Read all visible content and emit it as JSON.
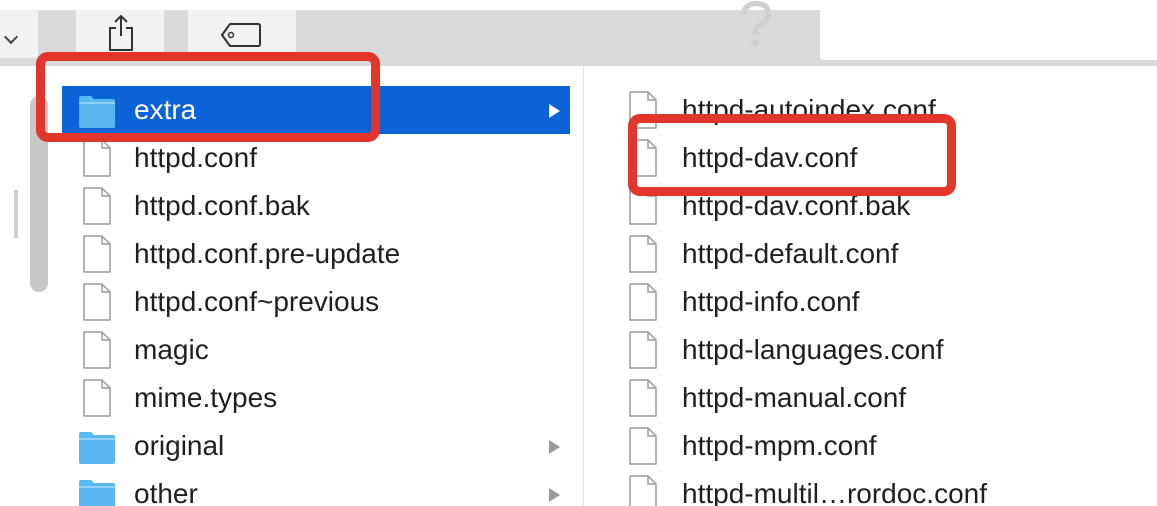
{
  "toolbar": {
    "buttons": [
      {
        "name": "view-options",
        "icon": "chevron-down-icon"
      },
      {
        "name": "share",
        "icon": "share-icon"
      },
      {
        "name": "tags",
        "icon": "tag-icon"
      }
    ],
    "help_glyph": "?"
  },
  "left_column": {
    "items": [
      {
        "label": "extra",
        "kind": "folder",
        "selected": true,
        "has_children": true
      },
      {
        "label": "httpd.conf",
        "kind": "file"
      },
      {
        "label": "httpd.conf.bak",
        "kind": "file"
      },
      {
        "label": "httpd.conf.pre-update",
        "kind": "file"
      },
      {
        "label": "httpd.conf~previous",
        "kind": "file"
      },
      {
        "label": "magic",
        "kind": "file"
      },
      {
        "label": "mime.types",
        "kind": "file"
      },
      {
        "label": "original",
        "kind": "folder",
        "has_children": true
      },
      {
        "label": "other",
        "kind": "folder",
        "has_children": true
      }
    ]
  },
  "right_column": {
    "items": [
      {
        "label": "httpd-autoindex.conf",
        "kind": "file"
      },
      {
        "label": "httpd-dav.conf",
        "kind": "file"
      },
      {
        "label": "httpd-dav.conf.bak",
        "kind": "file"
      },
      {
        "label": "httpd-default.conf",
        "kind": "file"
      },
      {
        "label": "httpd-info.conf",
        "kind": "file"
      },
      {
        "label": "httpd-languages.conf",
        "kind": "file"
      },
      {
        "label": "httpd-manual.conf",
        "kind": "file"
      },
      {
        "label": "httpd-mpm.conf",
        "kind": "file"
      },
      {
        "label": "httpd-multil…rordoc.conf",
        "kind": "file"
      }
    ]
  },
  "colors": {
    "selection": "#0c63d8",
    "folder": "#5ab8f0",
    "annotation": "#e2362b"
  }
}
